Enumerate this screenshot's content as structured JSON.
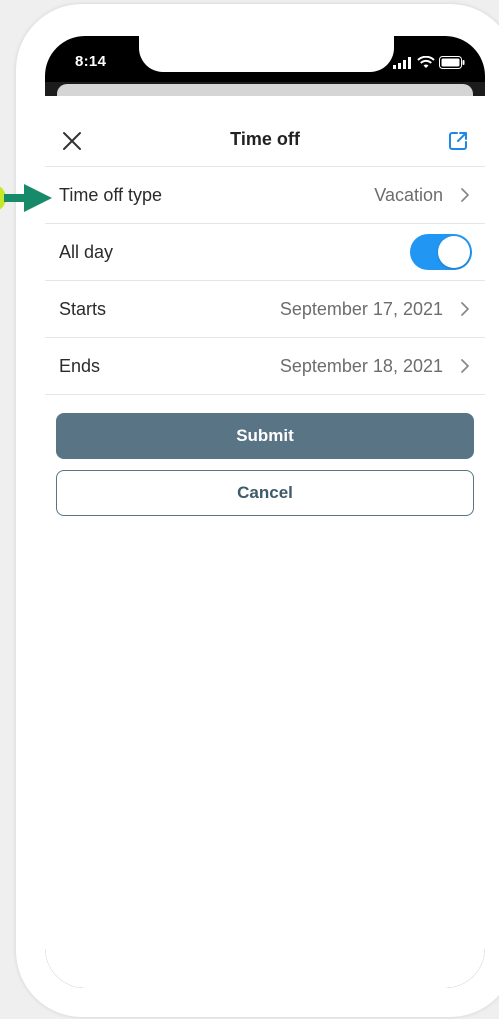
{
  "status_bar": {
    "time": "8:14"
  },
  "nav": {
    "title": "Time off"
  },
  "rows": [
    {
      "label": "Time off type",
      "value": "Vacation"
    },
    {
      "label": "All day",
      "toggle_on": true
    },
    {
      "label": "Starts",
      "value": "September 17, 2021"
    },
    {
      "label": "Ends",
      "value": "September 18, 2021"
    }
  ],
  "buttons": {
    "submit": "Submit",
    "cancel": "Cancel"
  },
  "colors": {
    "accent_toggle": "#2196f3",
    "submit_bg": "#587485",
    "annotation_arrow": "#178a6a",
    "annotation_dot": "#c6e82a"
  },
  "icons": {
    "close": "close-icon",
    "open_external": "external-link-icon",
    "chevron": "chevron-right-icon",
    "signal": "signal-icon",
    "wifi": "wifi-icon",
    "battery": "battery-icon"
  }
}
